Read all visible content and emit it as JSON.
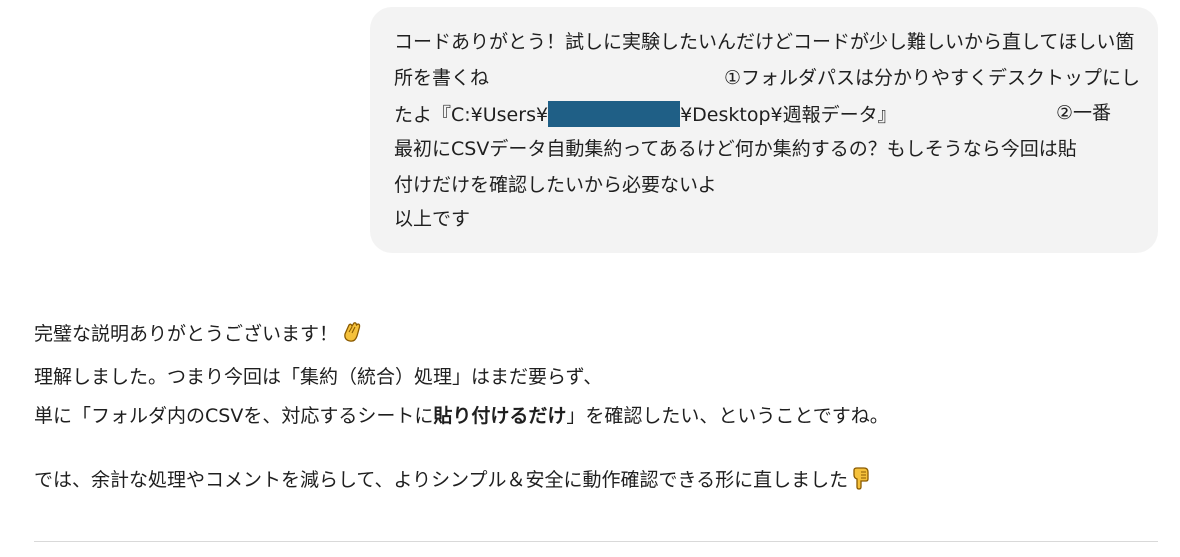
{
  "user_message": {
    "line1": "コードありがとう！試しに実験したいんだけどコードが少し難しいから直してほしい箇",
    "line2_a": "所を書くね",
    "line2_b": "①フォルダパスは分かりやすくデスクトップにし",
    "line3_a": "たよ『C:¥Users¥",
    "line3_b": "¥Desktop¥週報データ』",
    "line3_c": "②一番",
    "line4": "最初にCSVデータ自動集約ってあるけど何か集約するの？もしそうなら今回は貼",
    "line5": "付けだけを確認したいから必要ないよ",
    "line6": "以上です"
  },
  "assistant_message": {
    "line1": "完璧な説明ありがとうございます！",
    "line2": "理解しました。つまり今回は「集約（統合）処理」はまだ要らず、",
    "line3_a": "単に「フォルダ内のCSVを、対応するシートに",
    "line3_bold": "貼り付けるだけ",
    "line3_c": "」を確認したい、ということですね。",
    "line4": "では、余計な処理やコメントを減らして、よりシンプル＆安全に動作確認できる形に直しました"
  },
  "icons": {
    "clap": "clapping-hands-icon",
    "point_down": "pointing-down-icon"
  },
  "colors": {
    "bubble_bg": "#f3f3f3",
    "redaction": "#1f5f86",
    "emoji_yellow": "#f5c13b"
  }
}
